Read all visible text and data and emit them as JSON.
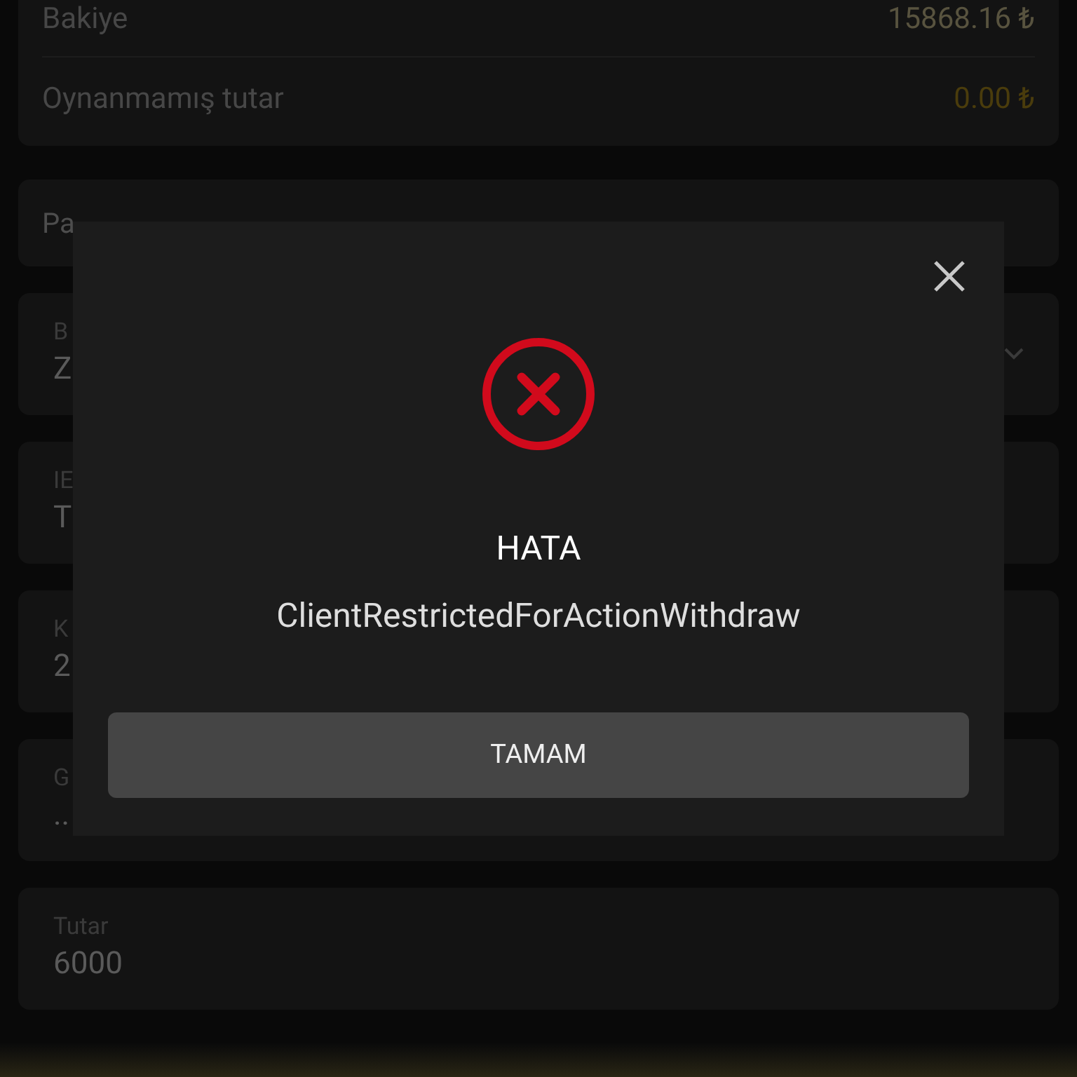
{
  "balance": [
    {
      "label": "Bakiye",
      "value": "15868.16 ₺",
      "kind": "balance"
    },
    {
      "label": "Oynanmamış tutar",
      "value": "0.00 ₺",
      "kind": "bonus"
    }
  ],
  "notice": "Pa",
  "fields": [
    {
      "label": "B",
      "value": "Z",
      "kind": "select"
    },
    {
      "label": "IE",
      "value": "T",
      "kind": "text"
    },
    {
      "label": "K",
      "value": "2",
      "kind": "text"
    },
    {
      "label": "G",
      "value": "..",
      "kind": "text"
    },
    {
      "label": "Tutar",
      "value": "6000",
      "kind": "text"
    }
  ],
  "dialog": {
    "title": "HATA",
    "message": "ClientRestrictedForActionWithdraw",
    "button": "TAMAM"
  }
}
